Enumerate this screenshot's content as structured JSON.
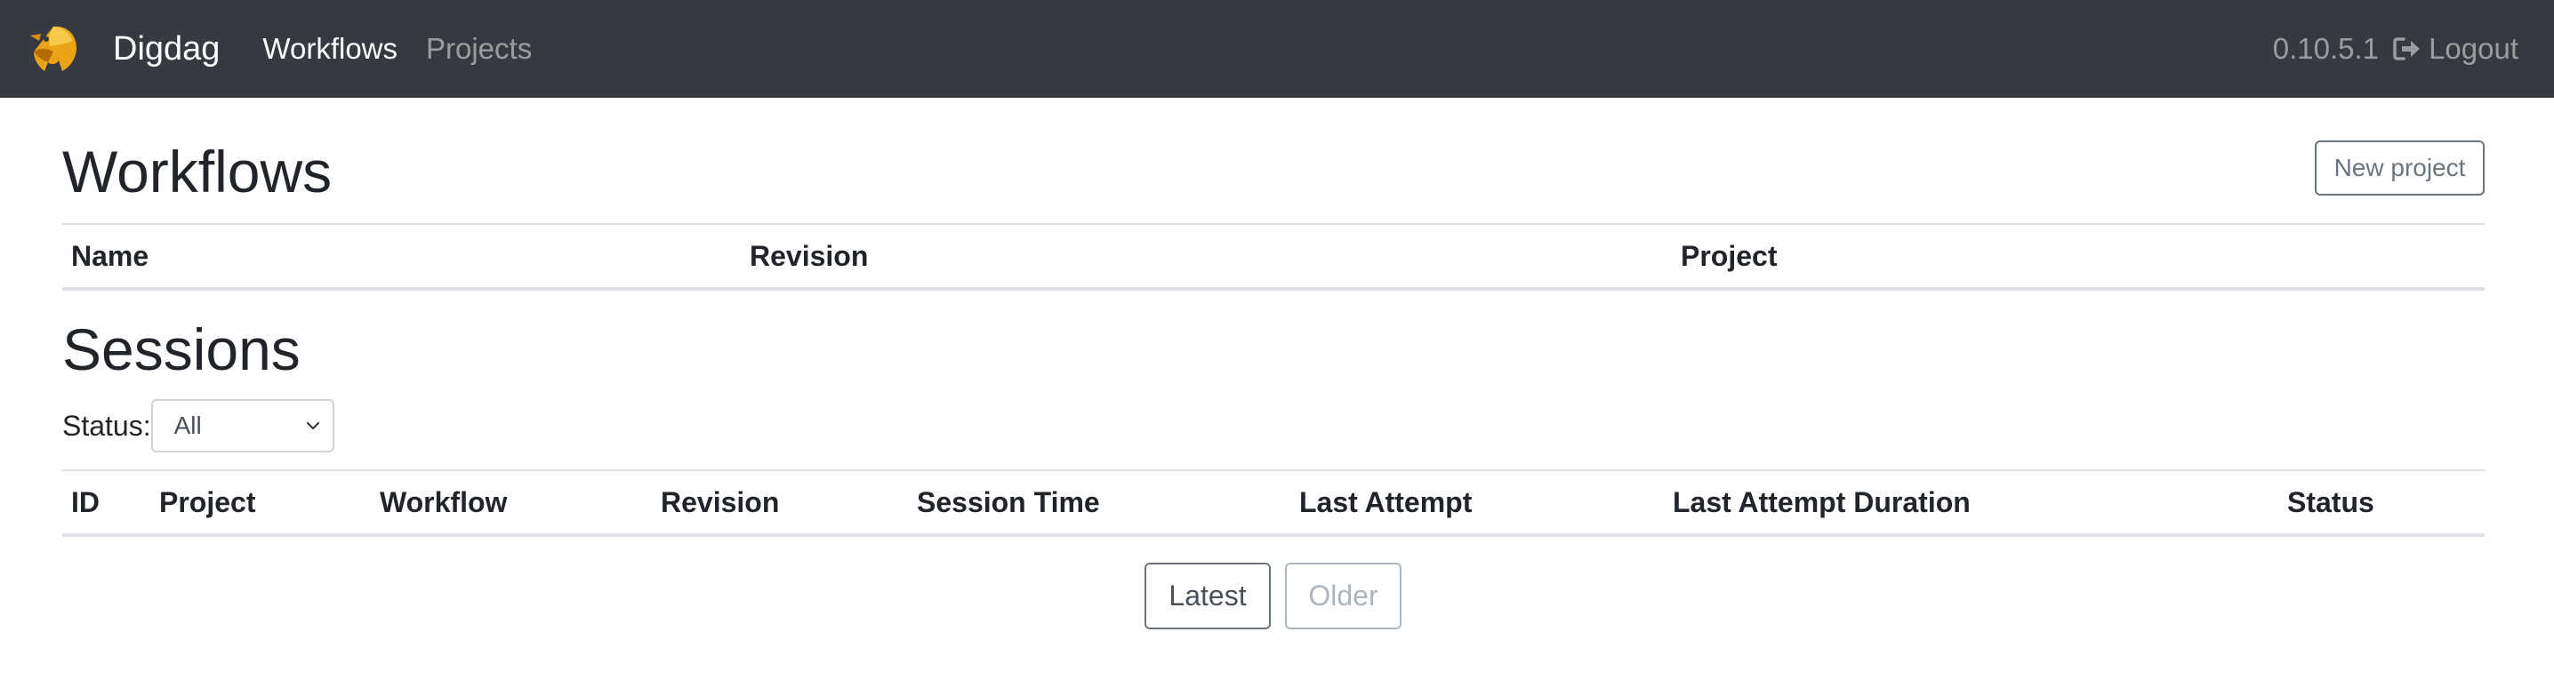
{
  "navbar": {
    "brand": "Digdag",
    "links": [
      "Workflows",
      "Projects"
    ],
    "version": "0.10.5.1",
    "logout_label": "Logout",
    "background": "#343a40",
    "logo_icon": "digdag-logo-icon",
    "logout_icon": "sign-out-icon"
  },
  "workflows": {
    "title": "Workflows",
    "new_project_label": "New project",
    "columns": [
      "Name",
      "Revision",
      "Project"
    ]
  },
  "sessions": {
    "title": "Sessions",
    "status_label": "Status:",
    "status_selected": "All",
    "columns": [
      "ID",
      "Project",
      "Workflow",
      "Revision",
      "Session Time",
      "Last Attempt",
      "Last Attempt Duration",
      "Status"
    ]
  },
  "pagination": {
    "latest_label": "Latest",
    "older_label": "Older"
  }
}
